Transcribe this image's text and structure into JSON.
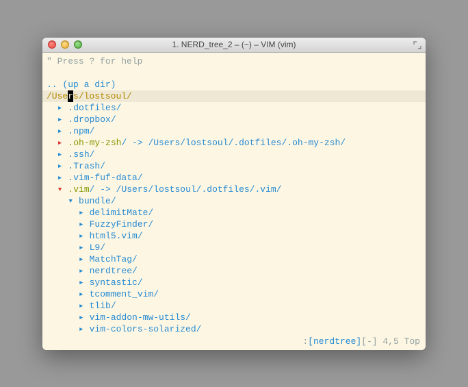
{
  "window": {
    "title": "1. NERD_tree_2 – (~) – VIM (vim)"
  },
  "help_line": {
    "quote": "\"",
    "text": " Press ? for help"
  },
  "up_dir": {
    "dots": "..",
    "label": " (up a dir)"
  },
  "cwd": {
    "pre": "/Use",
    "cursor_char": "r",
    "post": "s/lostsoul/"
  },
  "tree": {
    "indent1": "  ",
    "indent2": "    ",
    "indent3": "      ",
    "closed_arrow": "▸",
    "open_arrow": "▾",
    "items_top": [
      {
        "name": ".dotfiles/"
      },
      {
        "name": ".dropbox/"
      },
      {
        "name": ".npm/"
      }
    ],
    "ohmyzsh": {
      "name": ".oh-my-zsh",
      "sep": "/ -> ",
      "target": "/Users/lostsoul/.dotfiles/.oh-my-zsh/"
    },
    "items_mid": [
      {
        "name": ".ssh/"
      },
      {
        "name": ".Trash/"
      },
      {
        "name": ".vim-fuf-data/"
      }
    ],
    "vim": {
      "name": ".vim",
      "sep": "/ -> ",
      "target": "/Users/lostsoul/.dotfiles/.vim/"
    },
    "bundle_label": "bundle/",
    "bundle_items": [
      "delimitMate/",
      "FuzzyFinder/",
      "html5.vim/",
      "L9/",
      "MatchTag/",
      "nerdtree/",
      "syntastic/",
      "tcomment_vim/",
      "tlib/",
      "vim-addon-mw-utils/",
      "vim-colors-solarized/"
    ]
  },
  "status": {
    "colon": ":",
    "tag": "[nerdtree]",
    "rest": "[-] 4,5 Top"
  }
}
